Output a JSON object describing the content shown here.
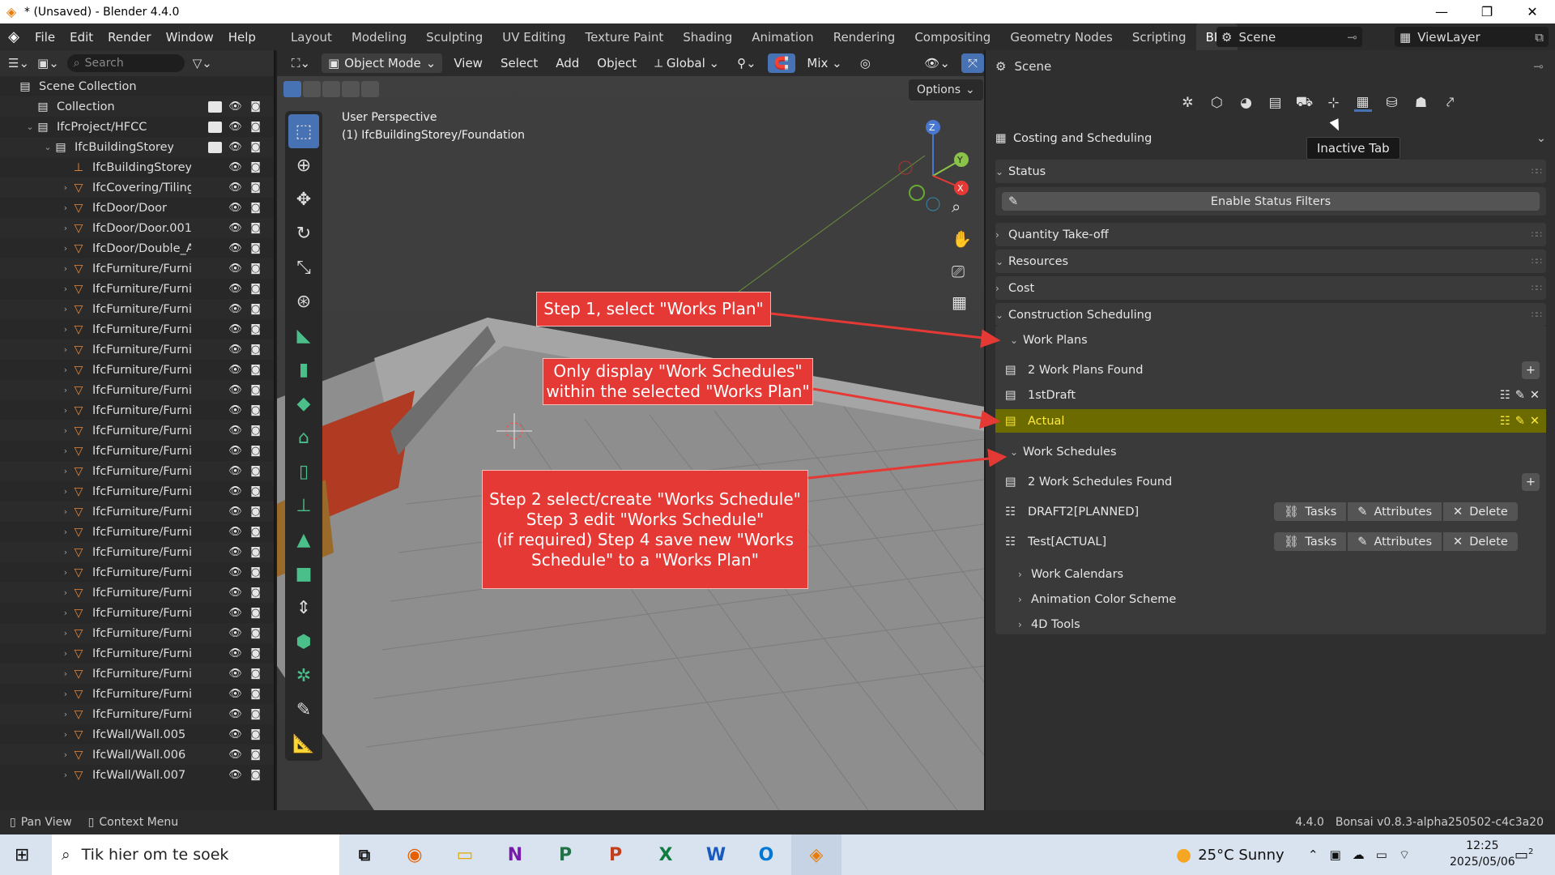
{
  "window": {
    "title": "* (Unsaved) - Blender 4.4.0",
    "minimize": "—",
    "maximize": "❐",
    "close": "✕"
  },
  "menu": [
    "File",
    "Edit",
    "Render",
    "Window",
    "Help"
  ],
  "workspaces": [
    "Layout",
    "Modeling",
    "Sculpting",
    "UV Editing",
    "Texture Paint",
    "Shading",
    "Animation",
    "Rendering",
    "Compositing",
    "Geometry Nodes",
    "Scripting",
    "BIM",
    "+"
  ],
  "active_workspace": "BIM",
  "scene_name": "Scene",
  "view_layer": "ViewLayer",
  "outliner": {
    "search_placeholder": "Search",
    "rows": [
      {
        "label": "Scene Collection",
        "indent": 0,
        "icon": "▤",
        "color": "#e6e6e6",
        "exp": "",
        "chk": false,
        "eye": false
      },
      {
        "label": "Collection",
        "indent": 1,
        "icon": "▤",
        "color": "#e6e6e6",
        "exp": "",
        "chk": true,
        "eye": true
      },
      {
        "label": "IfcProject/HFCC",
        "indent": 1,
        "icon": "▤",
        "color": "#e6e6e6",
        "exp": "⌄",
        "chk": true,
        "eye": true
      },
      {
        "label": "IfcBuildingStorey/Grou",
        "indent": 2,
        "icon": "▤",
        "color": "#e6e6e6",
        "exp": "⌄",
        "chk": true,
        "eye": true
      },
      {
        "label": "IfcBuildingStorey/(",
        "indent": 3,
        "icon": "⊥",
        "color": "#e8883a",
        "exp": "",
        "chk": false,
        "eye": true
      },
      {
        "label": "IfcCovering/Tiling",
        "indent": 3,
        "icon": "▽",
        "color": "#e8883a",
        "exp": "›",
        "chk": false,
        "eye": true
      },
      {
        "label": "IfcDoor/Door",
        "indent": 3,
        "icon": "▽",
        "color": "#e8883a",
        "exp": "›",
        "chk": false,
        "eye": true
      },
      {
        "label": "IfcDoor/Door.001",
        "indent": 3,
        "icon": "▽",
        "color": "#e8883a",
        "exp": "›",
        "chk": false,
        "eye": true
      },
      {
        "label": "IfcDoor/Double_Al",
        "indent": 3,
        "icon": "▽",
        "color": "#e8883a",
        "exp": "›",
        "chk": false,
        "eye": true
      },
      {
        "label": "IfcFurniture/Furnit",
        "indent": 3,
        "icon": "▽",
        "color": "#e8883a",
        "exp": "›",
        "chk": false,
        "eye": true
      },
      {
        "label": "IfcFurniture/Furnit",
        "indent": 3,
        "icon": "▽",
        "color": "#e8883a",
        "exp": "›",
        "chk": false,
        "eye": true
      },
      {
        "label": "IfcFurniture/Furnit",
        "indent": 3,
        "icon": "▽",
        "color": "#e8883a",
        "exp": "›",
        "chk": false,
        "eye": true
      },
      {
        "label": "IfcFurniture/Furnit",
        "indent": 3,
        "icon": "▽",
        "color": "#e8883a",
        "exp": "›",
        "chk": false,
        "eye": true
      },
      {
        "label": "IfcFurniture/Furnit",
        "indent": 3,
        "icon": "▽",
        "color": "#e8883a",
        "exp": "›",
        "chk": false,
        "eye": true
      },
      {
        "label": "IfcFurniture/Furnit",
        "indent": 3,
        "icon": "▽",
        "color": "#e8883a",
        "exp": "›",
        "chk": false,
        "eye": true
      },
      {
        "label": "IfcFurniture/Furnit",
        "indent": 3,
        "icon": "▽",
        "color": "#e8883a",
        "exp": "›",
        "chk": false,
        "eye": true
      },
      {
        "label": "IfcFurniture/Furnit",
        "indent": 3,
        "icon": "▽",
        "color": "#e8883a",
        "exp": "›",
        "chk": false,
        "eye": true
      },
      {
        "label": "IfcFurniture/Furnit",
        "indent": 3,
        "icon": "▽",
        "color": "#e8883a",
        "exp": "›",
        "chk": false,
        "eye": true
      },
      {
        "label": "IfcFurniture/Furnit",
        "indent": 3,
        "icon": "▽",
        "color": "#e8883a",
        "exp": "›",
        "chk": false,
        "eye": true
      },
      {
        "label": "IfcFurniture/Furnit",
        "indent": 3,
        "icon": "▽",
        "color": "#e8883a",
        "exp": "›",
        "chk": false,
        "eye": true
      },
      {
        "label": "IfcFurniture/Furnit",
        "indent": 3,
        "icon": "▽",
        "color": "#e8883a",
        "exp": "›",
        "chk": false,
        "eye": true
      },
      {
        "label": "IfcFurniture/Furnit",
        "indent": 3,
        "icon": "▽",
        "color": "#e8883a",
        "exp": "›",
        "chk": false,
        "eye": true
      },
      {
        "label": "IfcFurniture/Furnit",
        "indent": 3,
        "icon": "▽",
        "color": "#e8883a",
        "exp": "›",
        "chk": false,
        "eye": true
      },
      {
        "label": "IfcFurniture/Furnit",
        "indent": 3,
        "icon": "▽",
        "color": "#e8883a",
        "exp": "›",
        "chk": false,
        "eye": true
      },
      {
        "label": "IfcFurniture/Furnit",
        "indent": 3,
        "icon": "▽",
        "color": "#e8883a",
        "exp": "›",
        "chk": false,
        "eye": true
      },
      {
        "label": "IfcFurniture/Furnit",
        "indent": 3,
        "icon": "▽",
        "color": "#e8883a",
        "exp": "›",
        "chk": false,
        "eye": true
      },
      {
        "label": "IfcFurniture/Furnit",
        "indent": 3,
        "icon": "▽",
        "color": "#e8883a",
        "exp": "›",
        "chk": false,
        "eye": true
      },
      {
        "label": "IfcFurniture/Furnit",
        "indent": 3,
        "icon": "▽",
        "color": "#e8883a",
        "exp": "›",
        "chk": false,
        "eye": true
      },
      {
        "label": "IfcFurniture/Furnit",
        "indent": 3,
        "icon": "▽",
        "color": "#e8883a",
        "exp": "›",
        "chk": false,
        "eye": true
      },
      {
        "label": "IfcFurniture/Furnit",
        "indent": 3,
        "icon": "▽",
        "color": "#e8883a",
        "exp": "›",
        "chk": false,
        "eye": true
      },
      {
        "label": "IfcFurniture/Furnit",
        "indent": 3,
        "icon": "▽",
        "color": "#e8883a",
        "exp": "›",
        "chk": false,
        "eye": true
      },
      {
        "label": "IfcFurniture/Furnit",
        "indent": 3,
        "icon": "▽",
        "color": "#e8883a",
        "exp": "›",
        "chk": false,
        "eye": true
      },
      {
        "label": "IfcWall/Wall.005",
        "indent": 3,
        "icon": "▽",
        "color": "#e8883a",
        "exp": "›",
        "chk": false,
        "eye": true
      },
      {
        "label": "IfcWall/Wall.006",
        "indent": 3,
        "icon": "▽",
        "color": "#e8883a",
        "exp": "›",
        "chk": false,
        "eye": true
      },
      {
        "label": "IfcWall/Wall.007",
        "indent": 3,
        "icon": "▽",
        "color": "#e8883a",
        "exp": "›",
        "chk": false,
        "eye": true
      }
    ]
  },
  "viewport": {
    "mode": "Object Mode",
    "menus": [
      "View",
      "Select",
      "Add",
      "Object"
    ],
    "orientation": "Global",
    "snap_mode": "Mix",
    "options": "Options",
    "perspective": "User Perspective",
    "active_object": "(1) IfcBuildingStorey/Foundation",
    "gizmo_axes": {
      "x": "X",
      "y": "Y",
      "z": "Z"
    }
  },
  "annotations": {
    "step1": "Step 1, select \"Works Plan\"",
    "note2_line1": "Only display \"Work Schedules\"",
    "note2_line2": "within the selected \"Works Plan\"",
    "step2_line1": "Step 2 select/create \"Works Schedule\"",
    "step2_line2": "Step 3 edit \"Works Schedule\"",
    "step2_line3": "(if required) Step 4 save new \"Works",
    "step2_line4": "Schedule\" to a \"Works Plan\""
  },
  "properties": {
    "context": "Scene",
    "tab_title": "Costing and Scheduling",
    "tooltip": "Inactive Tab",
    "status": "Status",
    "enable_status_filters": "Enable Status Filters",
    "quantity_takeoff": "Quantity Take-off",
    "resources": "Resources",
    "cost": "Cost",
    "construction_scheduling": "Construction Scheduling",
    "work_plans": "Work Plans",
    "work_plans_found": "2 Work Plans Found",
    "plans": [
      "1stDraft",
      "Actual"
    ],
    "active_plan": "Actual",
    "work_schedules": "Work Schedules",
    "work_schedules_found": "2 Work Schedules Found",
    "schedules": [
      "DRAFT2[PLANNED]",
      "Test[ACTUAL]"
    ],
    "tasks_label": "Tasks",
    "attributes_label": "Attributes",
    "delete_label": "Delete",
    "work_calendars": "Work Calendars",
    "animation_color_scheme": "Animation Color Scheme",
    "tools_4d": "4D Tools",
    "highlight_color": "#6b6b00"
  },
  "statusbar": {
    "pan_view": "Pan View",
    "context_menu": "Context Menu",
    "version": "4.4.0",
    "bonsai": "Bonsai v0.8.3-alpha250502-c4c3a20"
  },
  "taskbar": {
    "search_placeholder": "Tik hier om te soek",
    "apps": [
      "firefox-icon",
      "files-icon",
      "onenote-icon",
      "project-icon",
      "powerpoint-icon",
      "excel-icon",
      "word-icon",
      "outlook-icon",
      "blender-icon"
    ],
    "app_letters": [
      "◉",
      "▭",
      "N",
      "P",
      "P",
      "X",
      "W",
      "O",
      "◈"
    ],
    "weather": "25°C  Sunny",
    "time": "12:25",
    "date": "2025/05/06",
    "notifications": "2"
  }
}
